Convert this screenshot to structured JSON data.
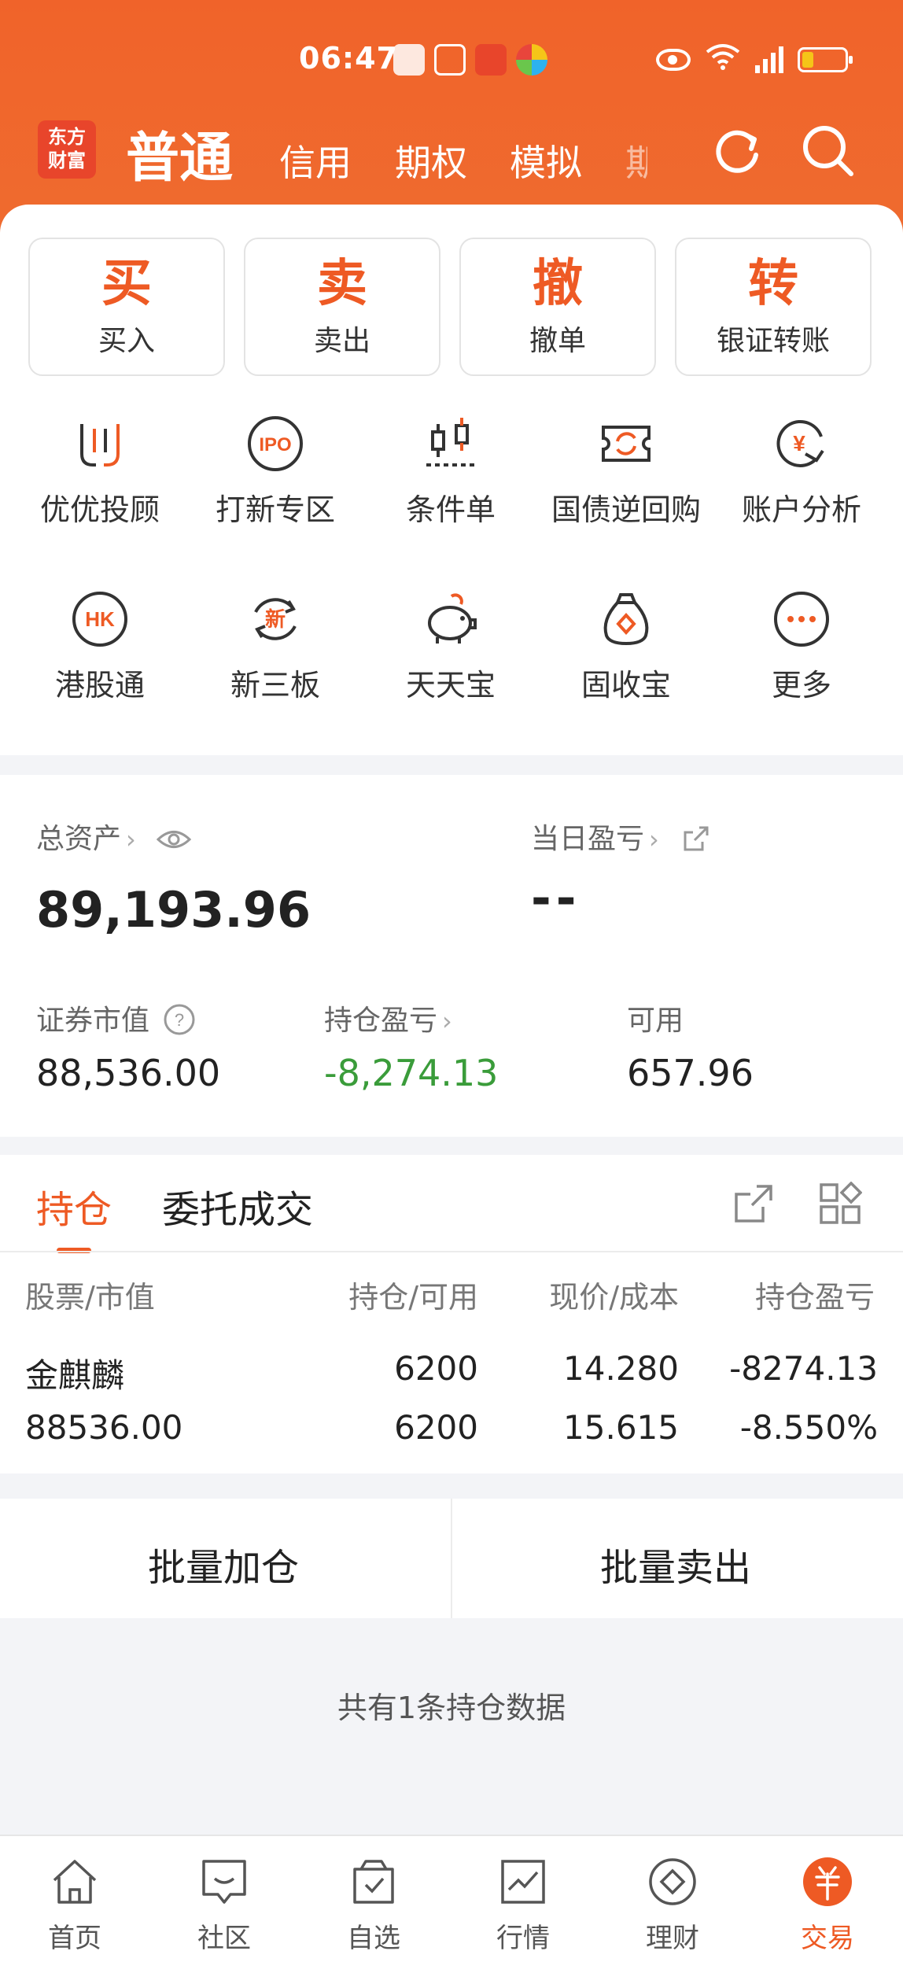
{
  "status_bar": {
    "time": "06:47"
  },
  "header": {
    "logo": [
      "东方",
      "财富"
    ],
    "tabs": [
      "普通",
      "信用",
      "期权",
      "模拟",
      "期"
    ]
  },
  "quick_actions": [
    {
      "big": "买",
      "label": "买入"
    },
    {
      "big": "卖",
      "label": "卖出"
    },
    {
      "big": "撤",
      "label": "撤单"
    },
    {
      "big": "转",
      "label": "银证转账"
    }
  ],
  "features": [
    {
      "label": "优优投顾",
      "icon": "uu-advisor-icon"
    },
    {
      "label": "打新专区",
      "icon": "ipo-icon",
      "badge": "IPO"
    },
    {
      "label": "条件单",
      "icon": "candlestick-icon"
    },
    {
      "label": "国债逆回购",
      "icon": "bond-repo-icon"
    },
    {
      "label": "账户分析",
      "icon": "account-analysis-icon",
      "badge": "¥"
    },
    {
      "label": "港股通",
      "icon": "hk-stock-icon",
      "badge": "HK"
    },
    {
      "label": "新三板",
      "icon": "new-third-board-icon",
      "badge": "新"
    },
    {
      "label": "天天宝",
      "icon": "piggy-bank-icon"
    },
    {
      "label": "固收宝",
      "icon": "money-bag-icon"
    },
    {
      "label": "更多",
      "icon": "more-icon"
    }
  ],
  "assets": {
    "total_label": "总资产",
    "total_value": "89,193.96",
    "daily_label": "当日盈亏",
    "daily_value": "--",
    "market_value_label": "证券市值",
    "market_value": "88,536.00",
    "position_pl_label": "持仓盈亏",
    "position_pl": "-8,274.13",
    "available_label": "可用",
    "available": "657.96"
  },
  "holdings": {
    "tabs": [
      "持仓",
      "委托成交"
    ],
    "columns": [
      "股票/市值",
      "持仓/可用",
      "现价/成本",
      "持仓盈亏"
    ],
    "rows": [
      {
        "name": "金麒麟",
        "market_value": "88536.00",
        "position": "6200",
        "available": "6200",
        "price": "14.280",
        "cost": "15.615",
        "pl": "-8274.13",
        "pl_pct": "-8.550%"
      }
    ]
  },
  "batch": {
    "add": "批量加仓",
    "sell": "批量卖出"
  },
  "note": "共有1条持仓数据",
  "tabbar": [
    {
      "label": "首页",
      "icon": "home-icon"
    },
    {
      "label": "社区",
      "icon": "community-icon"
    },
    {
      "label": "自选",
      "icon": "watchlist-icon"
    },
    {
      "label": "行情",
      "icon": "market-icon"
    },
    {
      "label": "理财",
      "icon": "wealth-icon"
    },
    {
      "label": "交易",
      "icon": "trade-icon",
      "active": true
    }
  ],
  "colors": {
    "accent": "#ee5a24",
    "gain_loss_green": "#3a9c3a"
  }
}
